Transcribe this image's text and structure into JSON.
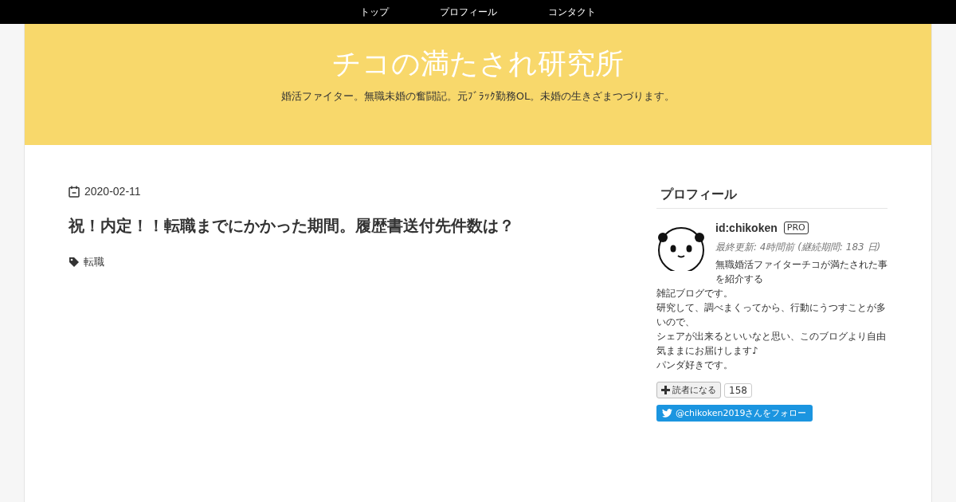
{
  "nav": [
    {
      "label": "トップ"
    },
    {
      "label": "プロフィール"
    },
    {
      "label": "コンタクト"
    }
  ],
  "header": {
    "title": "チコの満たされ研究所",
    "tagline": "婚活ファイター。無職未婚の奮闘記。元ﾌﾞﾗｯｸ勤務OL。未婚の生きざまつづります。"
  },
  "article": {
    "date": "2020-02-11",
    "title": "祝！内定！！転職までにかかった期間。履歴書送付先件数は？",
    "tags": [
      "転職"
    ]
  },
  "sidebar": {
    "heading": "プロフィール",
    "user_id": "id:chikoken",
    "badge": "PRO",
    "updated": "最終更新: 4時間前 (継続期間: 183 日)",
    "description_lines": [
      "無職婚活ファイターチコが満たされた事を紹介する",
      "雑記ブログです。",
      "研究して、調べまくってから、行動にうつすことが多いので、",
      "シェアが出来るといいなと思い、このブログより自由気ままにお届けします♪",
      "パンダ好きです。"
    ],
    "subscribe_label": "読者になる",
    "subscriber_count": "158",
    "follow_label": "@chikoken2019さんをフォロー"
  }
}
